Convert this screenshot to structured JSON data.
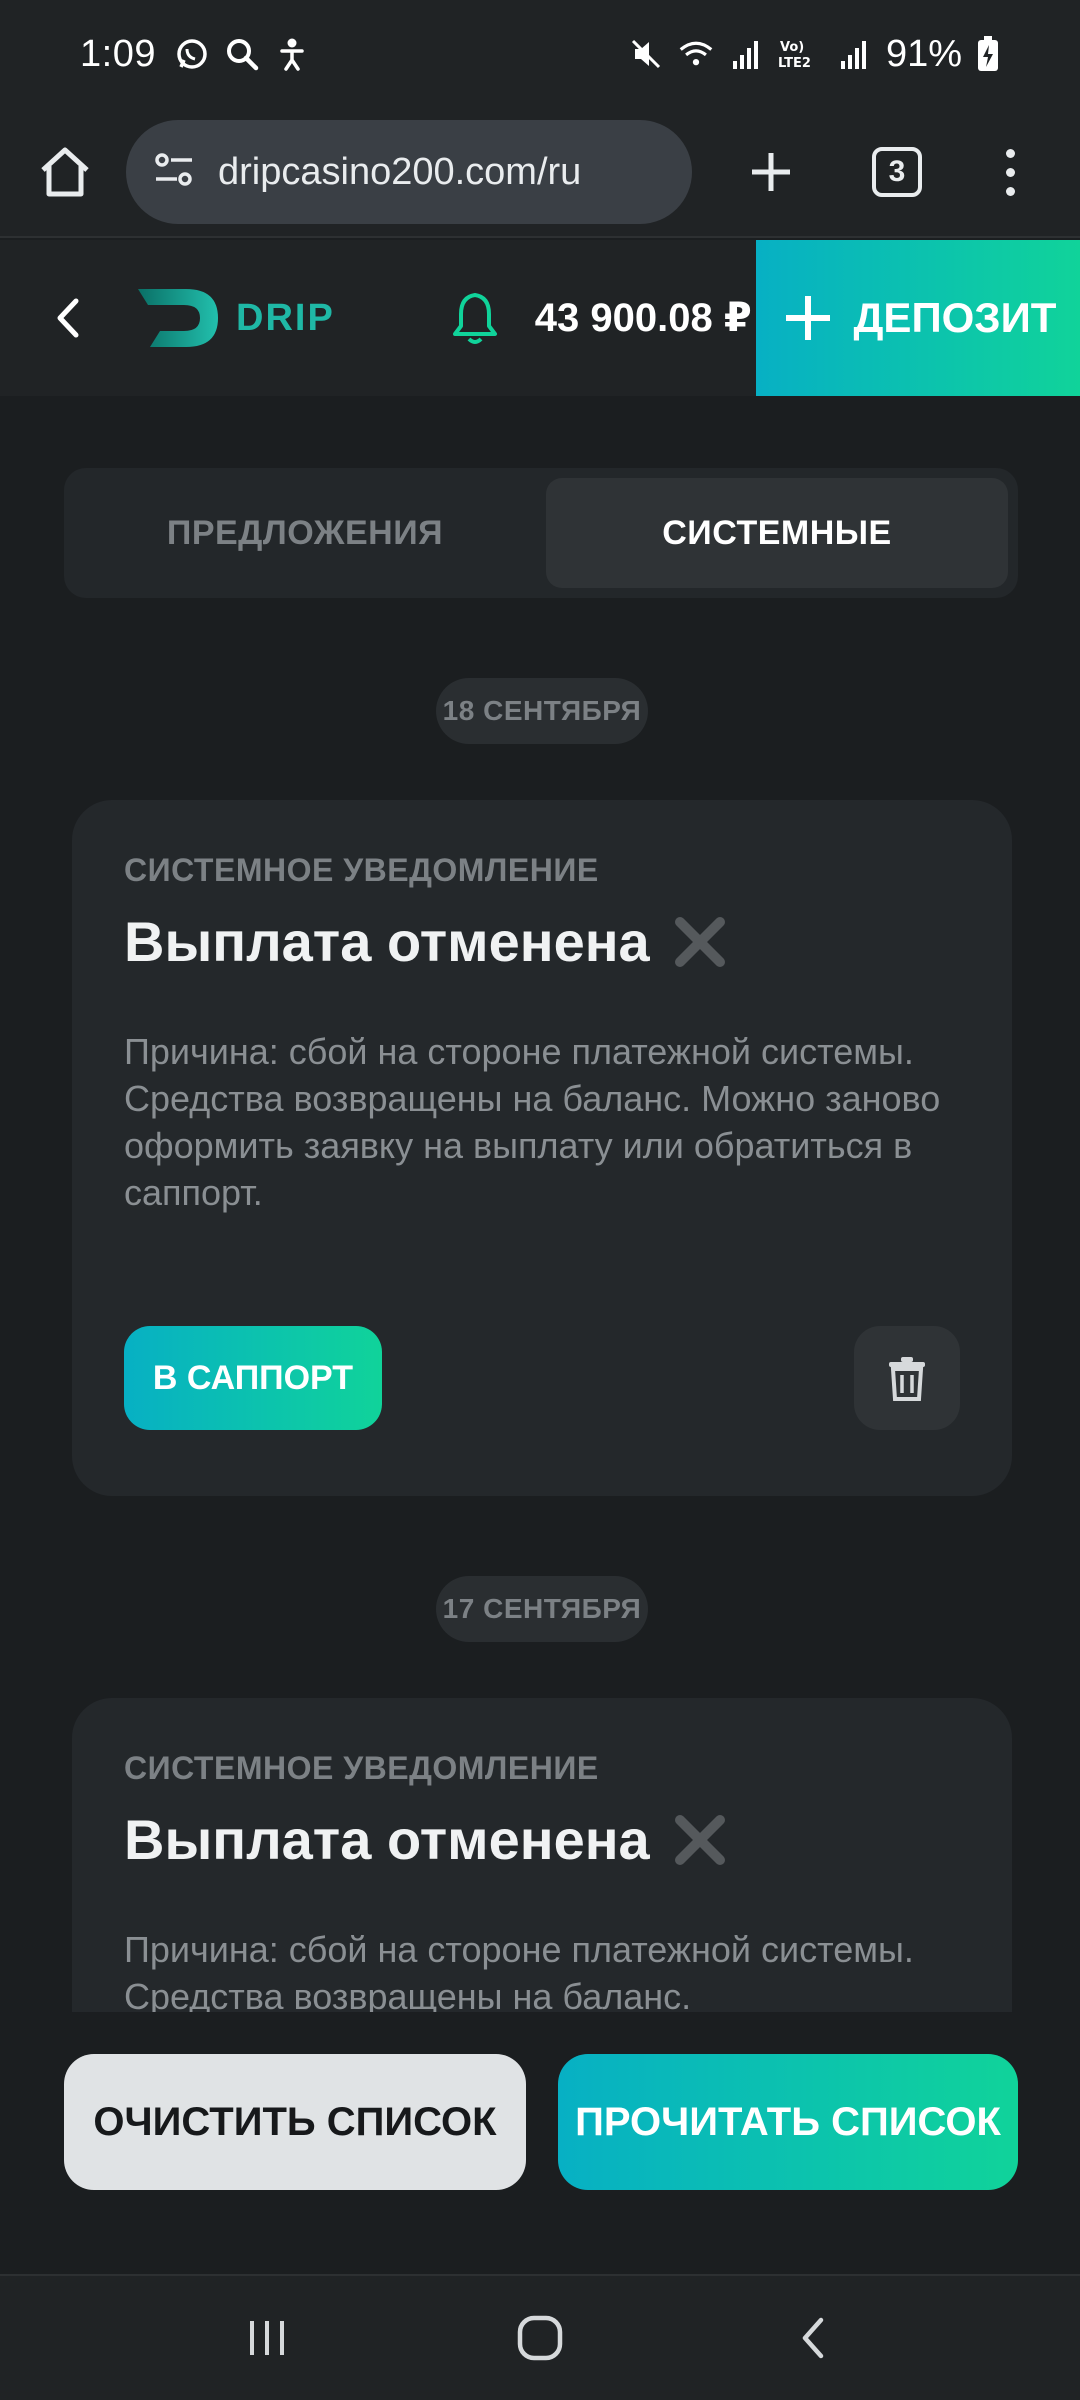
{
  "status_bar": {
    "time": "1:09",
    "battery": "91%",
    "icons_left": [
      "whatsapp-icon",
      "search-icon",
      "accessibility-icon"
    ],
    "icons_right": [
      "mute-icon",
      "wifi-icon",
      "signal-icon",
      "volte-icon",
      "signal-icon",
      "battery-charging-icon"
    ]
  },
  "browser": {
    "url": "dripcasino200.com/ru",
    "tab_count": "3"
  },
  "header": {
    "logo_text": "DRIP",
    "balance": "43 900.08 ₽",
    "deposit_label": "ДЕПОЗИТ",
    "accent_color": "#10d39a",
    "accent_color_2": "#07b0c4"
  },
  "tabs": [
    {
      "label": "ПРЕДЛОЖЕНИЯ",
      "active": false
    },
    {
      "label": "СИСТЕМНЫЕ",
      "active": true
    }
  ],
  "notifications": [
    {
      "date": "18 СЕНТЯБРЯ",
      "kicker": "СИСТЕМНОЕ УВЕДОМЛЕНИЕ",
      "title": "Выплата отменена",
      "body": "Причина: сбой на стороне платежной системы. Средства возвращены на баланс. Можно заново оформить заявку на выплату или обратиться в саппорт.",
      "support_label": "В САППОРТ"
    },
    {
      "date": "17 СЕНТЯБРЯ",
      "kicker": "СИСТЕМНОЕ УВЕДОМЛЕНИЕ",
      "title": "Выплата отменена",
      "body": "Причина: сбой на стороне платежной системы. Средства возвращены на баланс."
    }
  ],
  "bottom_actions": {
    "clear_label": "ОЧИСТИТЬ СПИСОК",
    "read_label": "ПРОЧИТАТЬ СПИСОК"
  }
}
